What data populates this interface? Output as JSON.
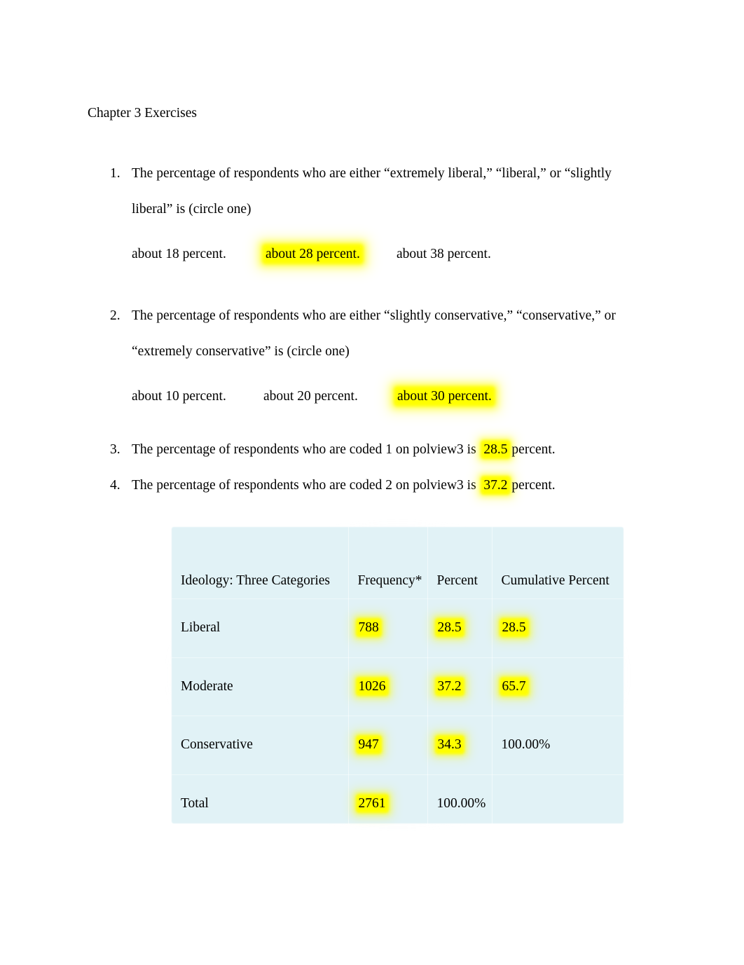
{
  "document": {
    "title": "Chapter 3 Exercises"
  },
  "questions": [
    {
      "number": "1.",
      "line1": "The percentage of respondents who are either “extremely liberal,” “liberal,” or “slightly",
      "line2": "liberal” is (circle one)",
      "options": [
        {
          "text": "about 18 percent.",
          "highlighted": false
        },
        {
          "text": "about 28 percent.",
          "highlighted": true
        },
        {
          "text": "about 38 percent.",
          "highlighted": false
        }
      ]
    },
    {
      "number": "2.",
      "line1": "The percentage of respondents who are either “slightly conservative,” “conservative,” or",
      "line2": "“extremely conservative” is (circle one)",
      "options": [
        {
          "text": "about 10 percent.",
          "highlighted": false
        },
        {
          "text": "about 20 percent.",
          "highlighted": false
        },
        {
          "text": "about 30 percent.",
          "highlighted": true
        }
      ]
    },
    {
      "number": "3.",
      "prefix": "The percentage of respondents who are coded 1 on polview3 is",
      "answer": "28.5",
      "suffix": "percent."
    },
    {
      "number": "4.",
      "prefix": "The percentage of respondents who are coded 2 on polview3 is",
      "answer": "37.2",
      "suffix": "percent."
    }
  ],
  "table": {
    "background_color": "#e1f2f6",
    "highlight_color": "#ffff00",
    "headers": [
      "Ideology: Three Categories",
      "Frequency*",
      "Percent",
      "Cumulative Percent"
    ],
    "rows": [
      {
        "label": "Liberal",
        "frequency": "788",
        "percent": "28.5",
        "cumulative": "28.5",
        "highlight": {
          "frequency": true,
          "percent": true,
          "cumulative": true
        }
      },
      {
        "label": "Moderate",
        "frequency": "1026",
        "percent": "37.2",
        "cumulative": "65.7",
        "highlight": {
          "frequency": true,
          "percent": true,
          "cumulative": true
        }
      },
      {
        "label": "Conservative",
        "frequency": "947",
        "percent": "34.3",
        "cumulative": "100.00%",
        "highlight": {
          "frequency": true,
          "percent": true,
          "cumulative": false
        }
      },
      {
        "label": "Total",
        "frequency": "2761",
        "percent": "100.00%",
        "cumulative": "",
        "highlight": {
          "frequency": true,
          "percent": false,
          "cumulative": false
        }
      }
    ]
  }
}
